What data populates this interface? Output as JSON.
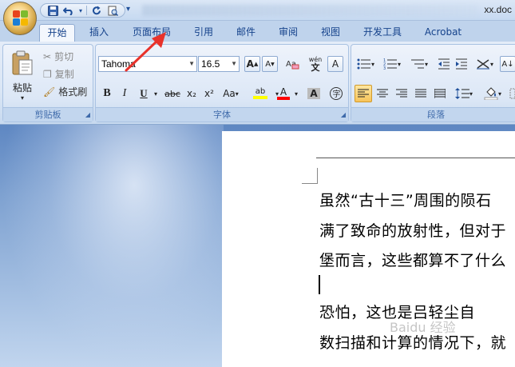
{
  "titlebar": {
    "title": "xx.doc"
  },
  "quick_access": {
    "icons": [
      "save-icon",
      "undo-icon",
      "redo-icon",
      "print-preview-icon"
    ]
  },
  "tabs": [
    {
      "label": "开始",
      "active": true
    },
    {
      "label": "插入",
      "active": false
    },
    {
      "label": "页面布局",
      "active": false
    },
    {
      "label": "引用",
      "active": false
    },
    {
      "label": "邮件",
      "active": false
    },
    {
      "label": "审阅",
      "active": false
    },
    {
      "label": "视图",
      "active": false
    },
    {
      "label": "开发工具",
      "active": false
    },
    {
      "label": "Acrobat",
      "active": false
    }
  ],
  "clipboard": {
    "paste_label": "粘贴",
    "cut_label": "剪切",
    "copy_label": "复制",
    "format_painter_label": "格式刷",
    "group_label": "剪贴板"
  },
  "font": {
    "font_name": "Tahoma",
    "font_size": "16.5",
    "bold": "B",
    "italic": "I",
    "underline": "U",
    "strike": "abc",
    "subscript": "x₂",
    "superscript": "x²",
    "change_case": "Aa",
    "highlight_label": "ab",
    "font_color_label": "A",
    "char_shading_label": "A",
    "grow_label": "A",
    "shrink_label": "A",
    "phonetic_label": "wén",
    "border_label": "A",
    "group_label": "字体",
    "highlight_color": "#ffff00",
    "font_color": "#ff0000"
  },
  "paragraph": {
    "group_label": "段落"
  },
  "document": {
    "lines": [
      "虽然“古十三”周围的陨石",
      "满了致命的放射性，但对于",
      "堡而言，这些都算不了什么",
      "",
      "    恐怕，这也是吕轻尘自",
      "数扫描和计算的情况下，就"
    ],
    "watermark": "Baidu 经验"
  },
  "colors": {
    "accent": "#15428b",
    "ribbon_bg": "#dce7f6",
    "arrow": "#e8322b"
  }
}
